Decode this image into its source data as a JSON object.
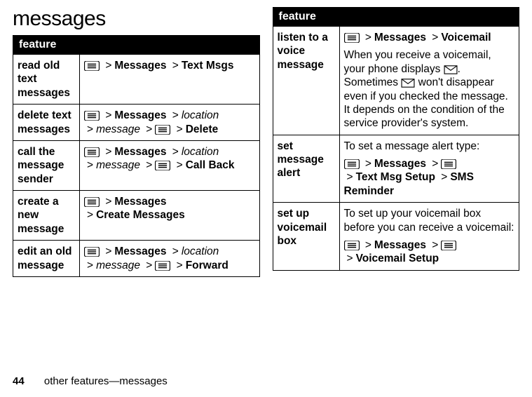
{
  "title": "messages",
  "tableHeader": "feature",
  "gt": ">",
  "messages_label": "Messages",
  "left": {
    "row1": {
      "feature": "read old text messages",
      "tail": "Text Msgs"
    },
    "row2": {
      "feature": "delete text messages",
      "loc": "location",
      "msg": "message",
      "del": "Delete"
    },
    "row3": {
      "feature": "call the message sender",
      "loc": "location",
      "msg": "message",
      "cb": "Call Back"
    },
    "row4": {
      "feature": "create a new message",
      "cm": "Create Messages"
    },
    "row5": {
      "feature": "edit an old message",
      "loc": "location",
      "msg": "message",
      "fw": "Forward"
    }
  },
  "right": {
    "row1": {
      "feature": "listen to a voice message",
      "vm": "Voicemail",
      "desc1": "When you receive a voicemail, your phone displays ",
      "desc2": ". Sometimes ",
      "desc3": " won't disappear even if you checked the message. It depends on the condition of the service provider's system."
    },
    "row2": {
      "feature": "set message alert",
      "lead": "To set a message alert type:",
      "t1": "Text Msg Setup",
      "t2": "SMS Reminder"
    },
    "row3": {
      "feature": "set up voicemail box",
      "lead": "To set up your voicemail box before you can receive a voicemail:",
      "vs": "Voicemail Setup"
    }
  },
  "footer": {
    "page": "44",
    "text": "other features—messages"
  }
}
